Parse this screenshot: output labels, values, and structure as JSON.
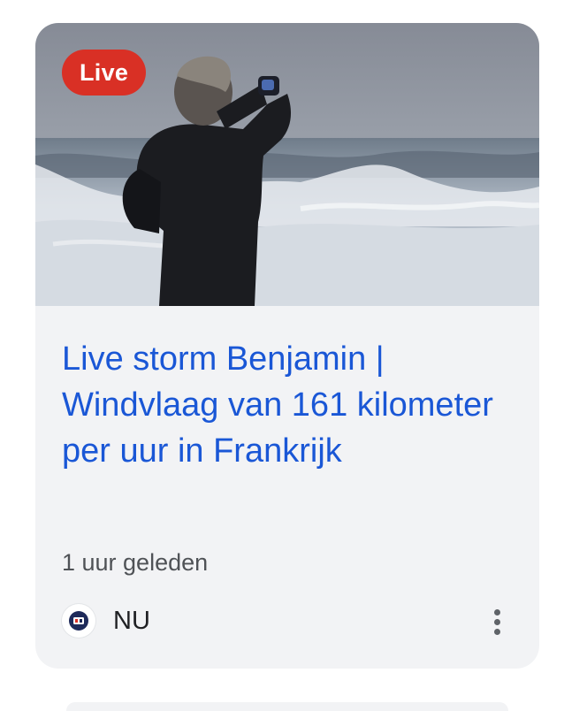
{
  "card": {
    "badge": "Live",
    "headline": "Live storm Benjamin | Windvlaag van 161 kilometer per uur in Frankrijk",
    "time": "1 uur geleden",
    "source": "NU",
    "image_subject": "person-photographing-stormy-sea",
    "more_icon": "more-vert-icon"
  },
  "colors": {
    "badge_bg": "#d93025",
    "headline": "#1a57d6",
    "card_bg": "#f2f3f5"
  }
}
